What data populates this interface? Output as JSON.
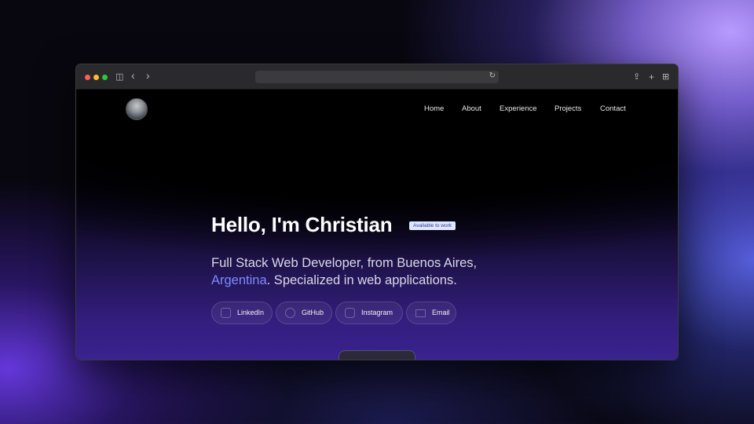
{
  "browser": {
    "back_icon": "‹",
    "forward_icon": "›",
    "sidebar_icon": "◫",
    "reload_icon": "↻",
    "share_icon": "⇪",
    "newtab_icon": "+",
    "tabs_icon": "⊞"
  },
  "nav": {
    "items": [
      "Home",
      "About",
      "Experience",
      "Projects",
      "Contact"
    ]
  },
  "hero": {
    "title": "Hello, I'm Christian",
    "badge": "Available to work",
    "subtitle_part1": "Full Stack Web Developer, from Buenos Aires,",
    "subtitle_accent": "Argentina",
    "subtitle_part2": ". Specialized in web applications."
  },
  "social_buttons": [
    {
      "label": "LinkedIn",
      "icon": "linkedin-icon"
    },
    {
      "label": "GitHub",
      "icon": "github-icon"
    },
    {
      "label": "Instagram",
      "icon": "instagram-icon"
    },
    {
      "label": "Email",
      "icon": "email-icon"
    }
  ],
  "colors": {
    "accent": "#7b8cff",
    "badge_bg": "#dfe6ff",
    "traffic_red": "#fe5f57",
    "traffic_yellow": "#febc2e",
    "traffic_green": "#28c840"
  }
}
